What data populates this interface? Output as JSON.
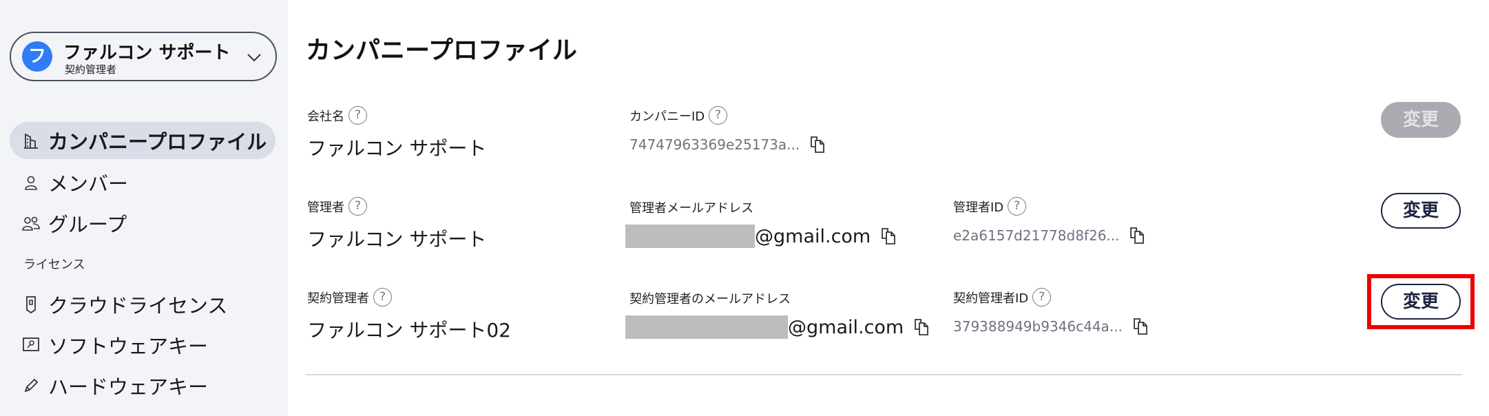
{
  "account": {
    "initial": "フ",
    "name": "ファルコン サポート",
    "role": "契約管理者"
  },
  "sidebar": {
    "items": [
      {
        "label": "カンパニープロファイル",
        "icon": "building-icon",
        "active": true
      },
      {
        "label": "メンバー",
        "icon": "person-icon"
      },
      {
        "label": "グループ",
        "icon": "people-icon"
      }
    ],
    "section_label": "ライセンス",
    "license_items": [
      {
        "label": "クラウドライセンス",
        "icon": "cloud-license-icon"
      },
      {
        "label": "ソフトウェアキー",
        "icon": "software-key-icon"
      },
      {
        "label": "ハードウェアキー",
        "icon": "pencil-icon"
      }
    ]
  },
  "main": {
    "title": "カンパニープロファイル",
    "row1": {
      "company_name_label": "会社名",
      "company_name": "ファルコン サポート",
      "company_id_label": "カンパニーID",
      "company_id": "74747963369e25173a...",
      "button": "変更"
    },
    "row2": {
      "admin_label": "管理者",
      "admin_name": "ファルコン サポート",
      "admin_email_label": "管理者メールアドレス",
      "admin_email_suffix": "@gmail.com",
      "admin_id_label": "管理者ID",
      "admin_id": "e2a6157d21778d8f26...",
      "button": "変更"
    },
    "row3": {
      "contract_label": "契約管理者",
      "contract_name": "ファルコン サポート02",
      "contract_email_label": "契約管理者のメールアドレス",
      "contract_email_suffix": "@gmail.com",
      "contract_id_label": "契約管理者ID",
      "contract_id": "379388949b9346c44a...",
      "button": "変更"
    }
  },
  "colors": {
    "avatar": "#2f7cf6",
    "sidebar_bg": "#f3f4f8",
    "active_nav": "#d9dde8",
    "highlight": "#ee0000"
  }
}
